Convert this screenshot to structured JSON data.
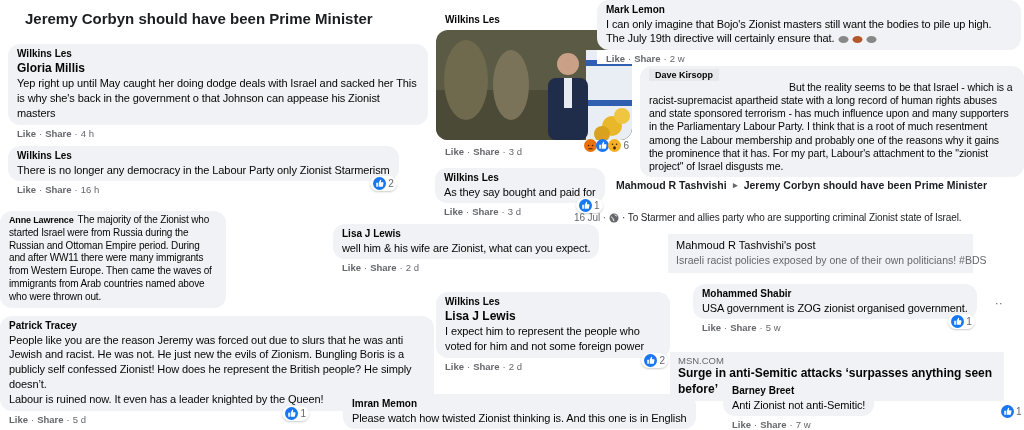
{
  "fragments": [
    {
      "kind": "heading",
      "text": "Jeremy Corbyn should have been Prime Minister"
    },
    {
      "kind": "comment",
      "author": "Mark Lemon",
      "text": "I can only imagine that Bojo's Zionist masters still want the bodies to pile up high. The July 19th directive will certainly ensure that.",
      "trailing_emoji": true,
      "actions": [
        "Like",
        "·",
        "Share",
        "·",
        "2 w"
      ]
    },
    {
      "kind": "image_post",
      "author": "Wilkins Les",
      "reactions": {
        "count": "6"
      },
      "actions": [
        "Like",
        "·",
        "Share",
        "·",
        "3 d"
      ]
    },
    {
      "kind": "comment",
      "author": "Wilkins Les",
      "reply_to": "Gloria Millis",
      "text": "Yep right up until May caught her doing dodge deals with Israel and sacked her This is why she's back in the government o that Johnson can appease his Zionist masters",
      "actions": [
        "Like",
        "·",
        "Share",
        "·",
        "4 h"
      ]
    },
    {
      "kind": "comment_indented",
      "author": "Dave Kirsopp",
      "text": "But the reality seems to be that Israel - which is a racist-supremacist apartheid state with a long record of human rights abuses and state sponsored terrorism - has much influence upon and many supporters in the Parliamentary Labour Party. I think that is a root of much resentment among the Labour membership and probably one of the reasons why it gains the prominence that it has. For my part, Labour's attachment to the \"zionist project\" of Israel disgusts me."
    },
    {
      "kind": "comment",
      "author": "Wilkins Les",
      "text": "There is no longer any democracy in the Labour Party only Zionist Starmerism",
      "reactions": {
        "count": "2"
      },
      "actions": [
        "Like",
        "·",
        "Share",
        "·",
        "16 h"
      ]
    },
    {
      "kind": "comment",
      "author": "Wilkins Les",
      "text": "As they say bought and paid for",
      "reactions": {
        "count": "1"
      },
      "actions": [
        "Like",
        "·",
        "Share",
        "·",
        "3 d"
      ]
    },
    {
      "kind": "post_header",
      "author": "Mahmoud R Tashvishi",
      "arrow": "▸",
      "target": "Jeremy Corbyn should have been Prime Minister"
    },
    {
      "kind": "comment_inline",
      "author": "Anne Lawrence",
      "text": "The majority of the Zionist who started Israel were from Russia during the Russian and Ottoman Empire period. During and after WW11 there were many immigrants from Western Europe. Then came the waves of immigrants from Arab countries named above who were thrown out."
    },
    {
      "kind": "post_line",
      "date": "16 Jul ·",
      "text": "· To Starmer and allies party who are supporting criminal Zionist state of Israel."
    },
    {
      "kind": "comment",
      "author": "Lisa J Lewis",
      "text": "well him & his wife are Zionist, what can you expect.",
      "actions": [
        "Like",
        "·",
        "Share",
        "·",
        "2 d"
      ]
    },
    {
      "kind": "shared_post",
      "title": "Mahmoud R Tashvishi's post",
      "text": "Israeli racist policies exposed by one of their own politicians! #BDS"
    },
    {
      "kind": "comment",
      "author": "Mohammed Shabir",
      "text": "USA government is ZOG zionist organised government.",
      "more": "··",
      "reactions": {
        "count": "1"
      },
      "actions": [
        "Like",
        "·",
        "Share",
        "·",
        "5 w"
      ]
    },
    {
      "kind": "comment",
      "author": "Wilkins Les",
      "reply_to": "Lisa J Lewis",
      "text": "I expect him to represent the people who voted for him and not some foreign power",
      "reactions": {
        "count": "2"
      },
      "actions": [
        "Like",
        "·",
        "Share",
        "·",
        "2 d"
      ]
    },
    {
      "kind": "comment",
      "author": "Patrick Tracey",
      "text": "People like you are the reason Jeremy was forced out due to slurs that he was anti Jewish and racist. He was not. He just new the evils of Zionism. Bungling Boris is a publicly self confessed Zionist! How does he represent the British people? He simply doesn’t.",
      "text_2": "Labour is ruined now. It even has a leader knighted by the Queen!",
      "reactions": {
        "count": "1"
      },
      "actions": [
        "Like",
        "·",
        "Share",
        "·",
        "5 d"
      ]
    },
    {
      "kind": "link_preview",
      "source": "MSN.COM",
      "title_lines": [
        "Surge in anti-Semitic attacks ‘surpasses anything seen",
        "before’"
      ]
    },
    {
      "kind": "comment",
      "author": "Imran Memon",
      "text": "Please watch how twisted Zionist thinking is. And this one is in English"
    },
    {
      "kind": "comment",
      "author": "Barney Breet",
      "text": "Anti Zionist not anti-Semitic!",
      "actions": [
        "Like",
        "·",
        "Share",
        "·",
        "7 w"
      ]
    },
    {
      "kind": "reaction",
      "reactions": {
        "count": "1"
      }
    }
  ]
}
